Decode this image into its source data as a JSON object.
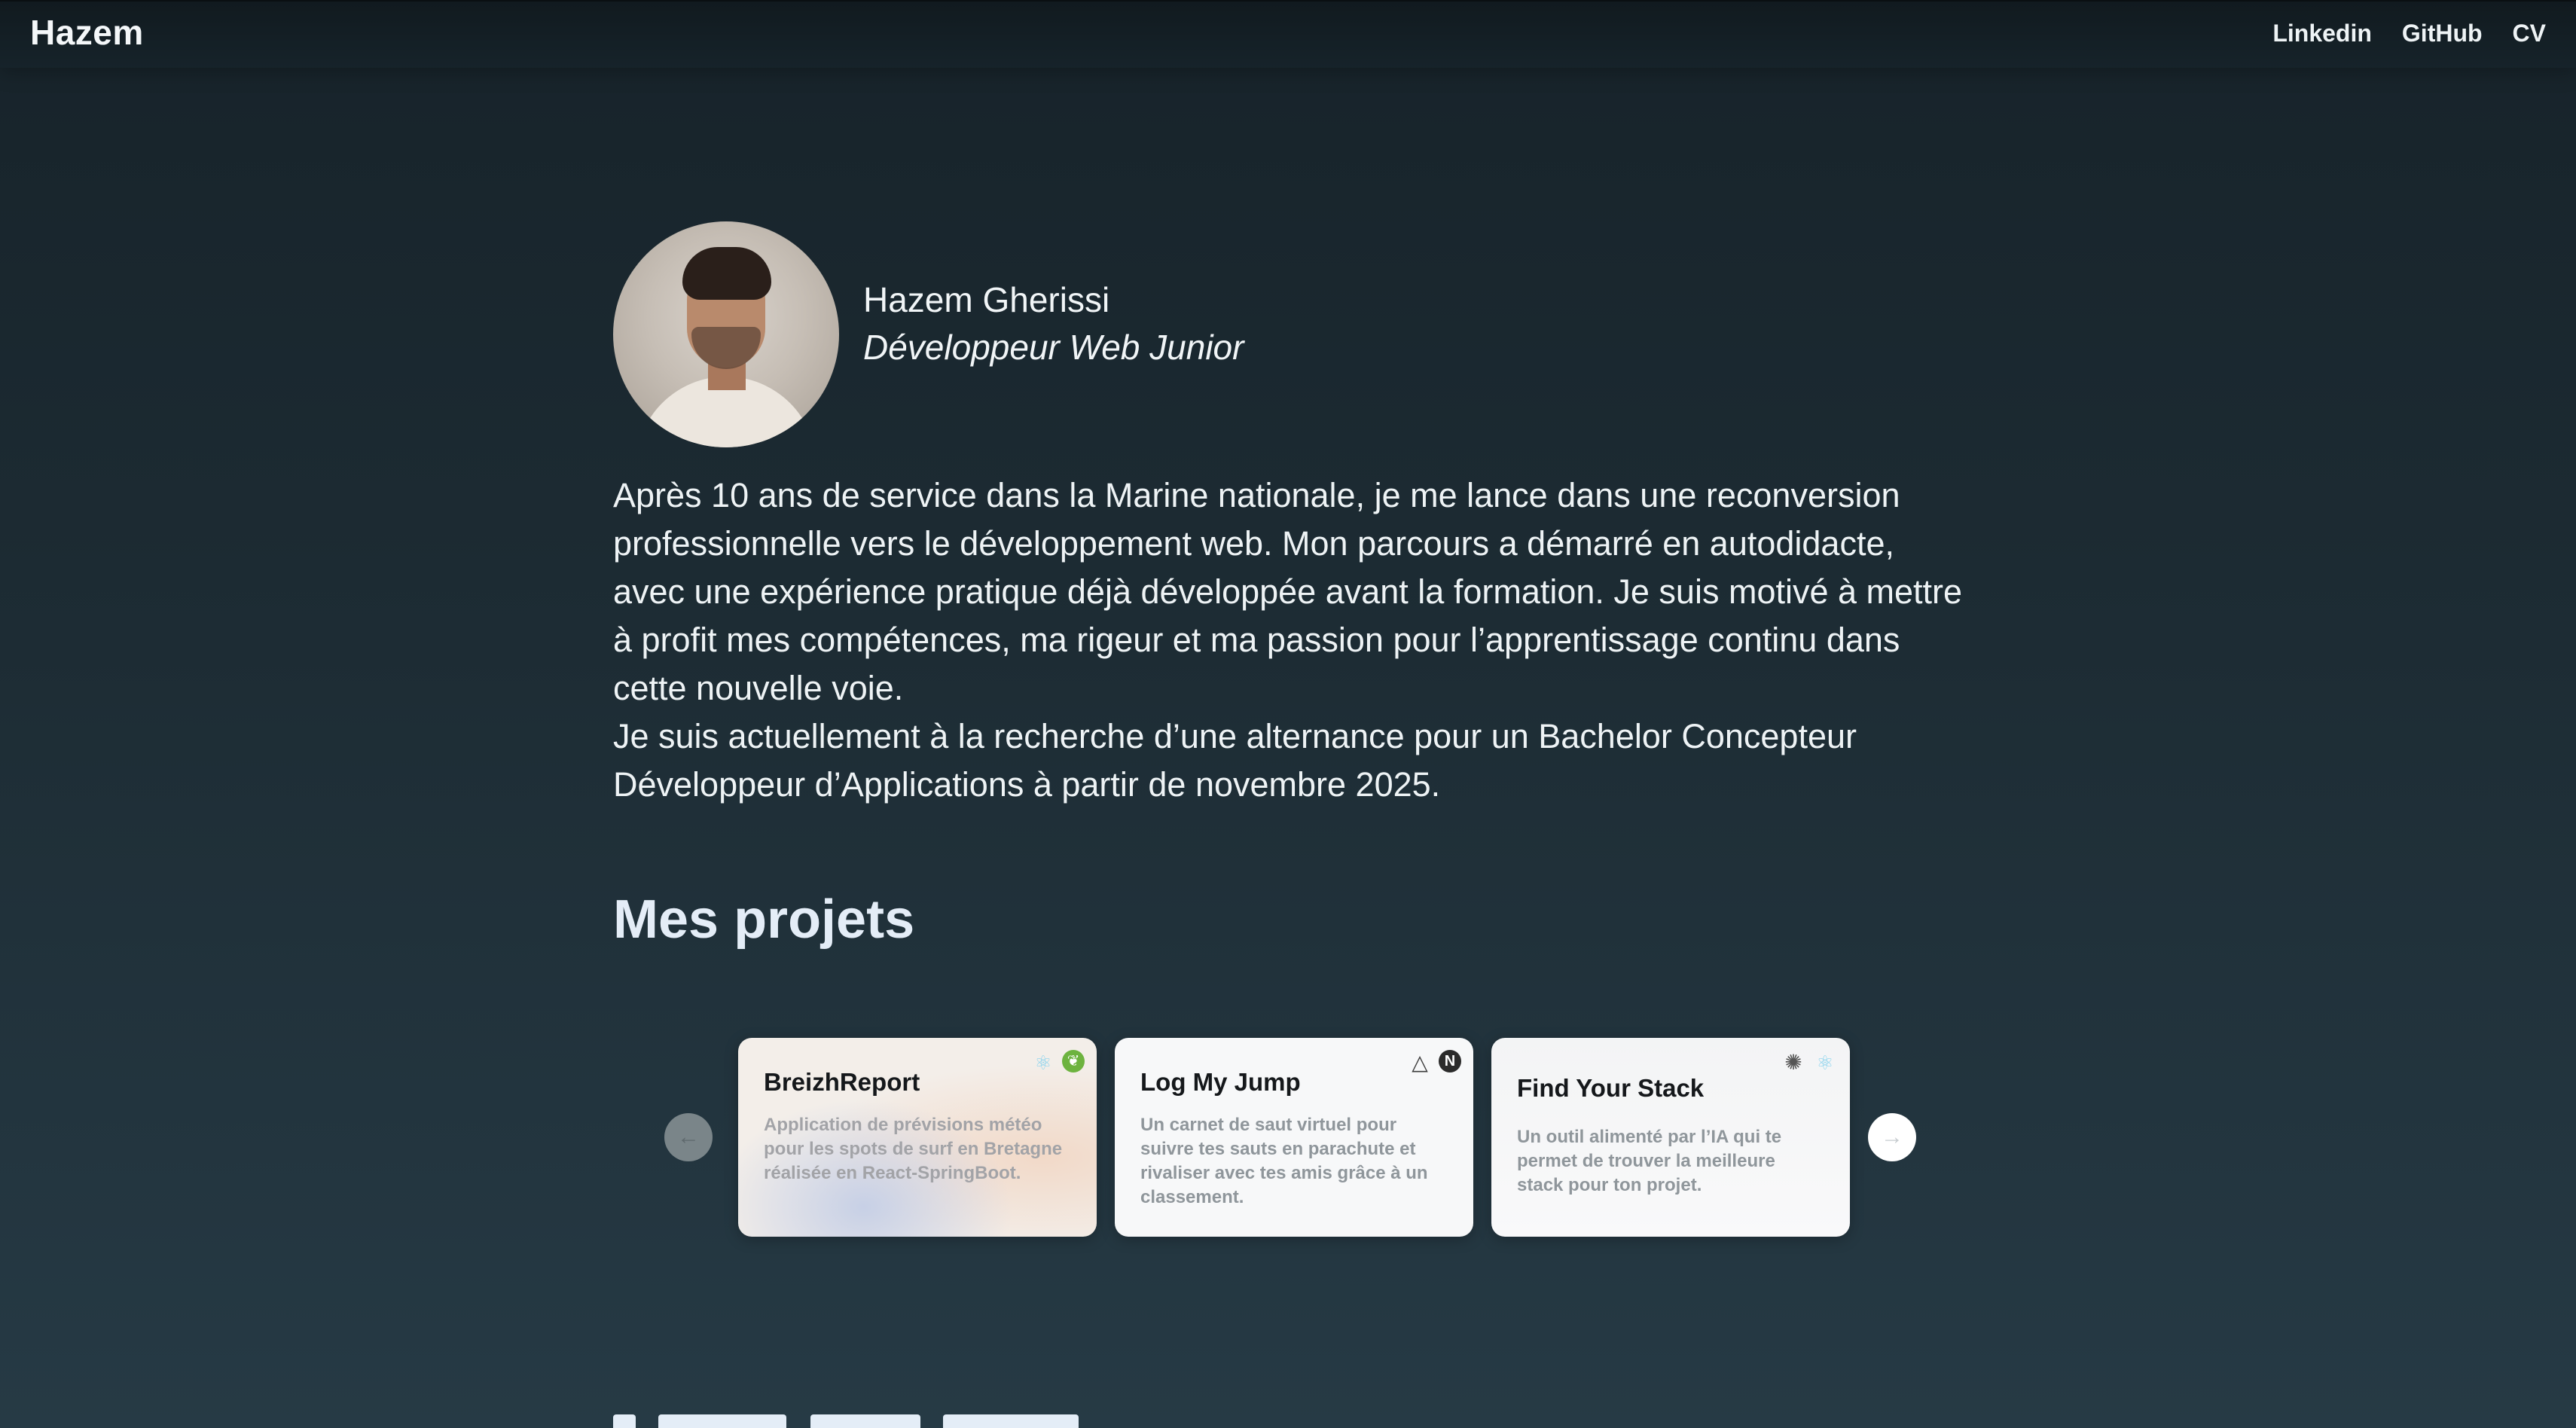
{
  "nav": {
    "brand": "Hazem",
    "links": [
      "Linkedin",
      "GitHub",
      "CV"
    ]
  },
  "profile": {
    "name": "Hazem Gherissi",
    "role": "Développeur Web Junior"
  },
  "bio": {
    "paragraph1": "Après 10 ans de service dans la Marine nationale, je me lance dans une reconversion professionnelle vers le développement web. Mon parcours a démarré en autodidacte, avec une expérience pratique déjà développée avant la formation. Je suis motivé à mettre à profit mes compétences, ma rigeur et ma passion pour l’apprentissage continu dans cette nouvelle voie.",
    "paragraph2": "Je suis actuellement à la recherche d’une alternance pour un Bachelor Concepteur Développeur d’Applications à partir de novembre 2025."
  },
  "projects": {
    "title": "Mes projets",
    "prev_glyph": "←",
    "next_glyph": "→",
    "items": [
      {
        "title": "BreizhReport",
        "description": "Application de prévisions météo pour les spots de surf en Bretagne réalisée en React-SpringBoot.",
        "icons": [
          "react-icon",
          "spring-icon"
        ]
      },
      {
        "title": "Log My Jump",
        "description": "Un carnet de saut virtuel pour suivre tes sauts en parachute et rivaliser avec tes amis grâce à un classement.",
        "icons": [
          "vercel-icon",
          "nextjs-icon"
        ]
      },
      {
        "title": "Find Your Stack",
        "description": "Un outil alimenté par l’IA qui te permet de trouver la meilleure stack pour ton projet.",
        "icons": [
          "openai-icon",
          "react-icon"
        ]
      }
    ]
  },
  "icon_glyphs": {
    "react": "⚛",
    "spring": "❦",
    "vercel": "△",
    "nextjs": "N",
    "openai": "✺"
  }
}
